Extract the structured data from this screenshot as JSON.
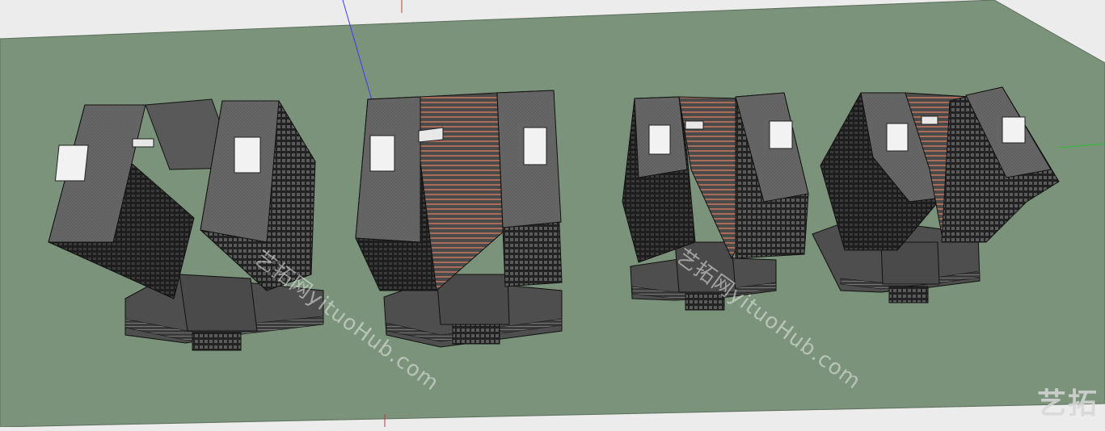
{
  "scene": {
    "description_type": "3d-model-viewport",
    "colors": {
      "background": "#ececec",
      "ground": "#7a937a",
      "ground_edge": "#5d6f5d",
      "roof": "#6b6b6b",
      "facade": "#2a2a2a",
      "skylight": "#f2f2f2",
      "accent_brick": "#a86c58",
      "axis_blue": "#3a3aff",
      "axis_green": "#2fbf2f",
      "axis_red": "#cc3333"
    }
  },
  "watermarks": {
    "text_1": "艺拓网yituoHub.com",
    "text_2": "艺拓网yituoHub.com",
    "logo": "艺拓"
  }
}
